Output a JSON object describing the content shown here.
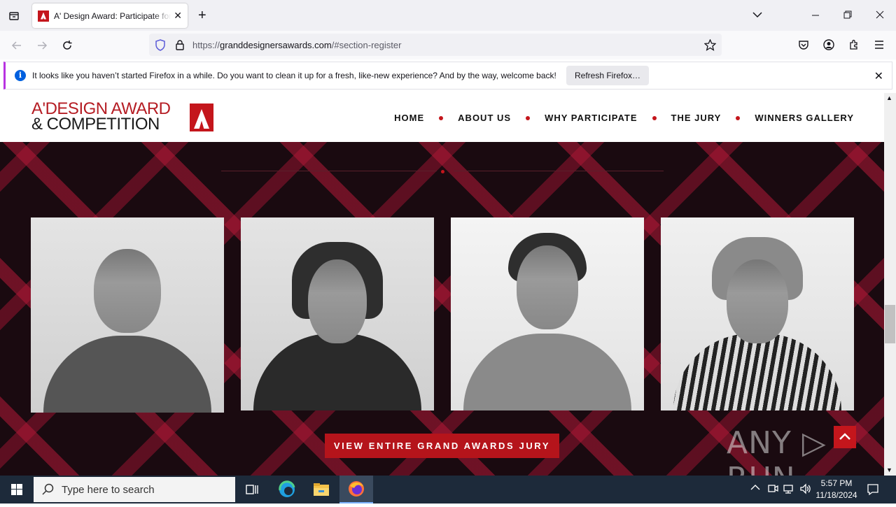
{
  "browser": {
    "tab_title": "A' Design Award: Participate for",
    "url_prefix": "https://",
    "url_host": "granddesignersawards.com",
    "url_path": "/#section-register",
    "notification_text": "It looks like you haven’t started Firefox in a while. Do you want to clean it up for a fresh, like-new experience? And by the way, welcome back!",
    "notification_button": "Refresh Firefox…"
  },
  "site": {
    "logo_line1": "A'DESIGN AWARD",
    "logo_line2": "& COMPETITION",
    "nav": [
      "HOME",
      "ABOUT US",
      "WHY PARTICIPATE",
      "THE JURY",
      "WINNERS GALLERY"
    ],
    "jury_button": "VIEW ENTIRE GRAND AWARDS JURY",
    "watermark": "ANY ▷ RUN"
  },
  "taskbar": {
    "search_placeholder": "Type here to search",
    "time": "5:57 PM",
    "date": "11/18/2024"
  },
  "colors": {
    "brand_red": "#c4161c",
    "hero_bg": "#1a0a10"
  }
}
